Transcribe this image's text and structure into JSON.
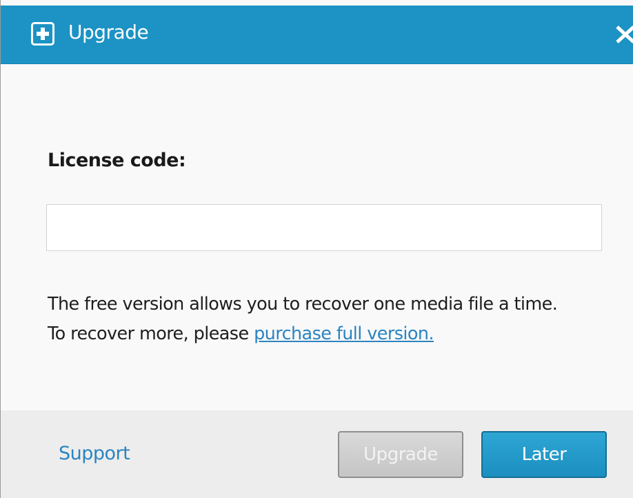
{
  "window": {
    "title": "Upgrade",
    "icon": "plus-square-icon",
    "close_icon": "close-icon"
  },
  "form": {
    "license_label": "License code:",
    "license_value": "",
    "license_placeholder": ""
  },
  "info": {
    "line1": "The free version allows you to recover one media file a time.",
    "line2_prefix": "To recover more, please ",
    "link_text": "purchase full version."
  },
  "footer": {
    "support_label": "Support",
    "upgrade_label": "Upgrade",
    "later_label": "Later"
  },
  "colors": {
    "titlebar": "#1c93c4",
    "link": "#2b84c1",
    "primary_button": "#1b8fc0",
    "disabled_button": "#c8c8c8"
  }
}
